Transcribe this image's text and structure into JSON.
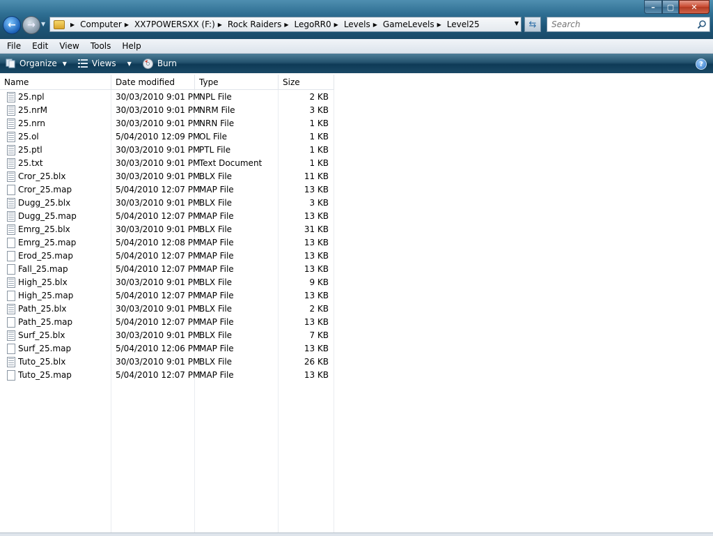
{
  "window": {
    "caption_buttons": {
      "minimize": "–",
      "maximize": "▢",
      "close": "✕"
    }
  },
  "nav": {
    "back_icon": "back-arrow-icon",
    "forward_icon": "forward-arrow-icon"
  },
  "address": {
    "breadcrumbs": [
      "Computer",
      "XX7POWERSXX (F:)",
      "Rock Raiders",
      "LegoRR0",
      "Levels",
      "GameLevels",
      "Level25"
    ]
  },
  "search": {
    "placeholder": "Search"
  },
  "menu": [
    "File",
    "Edit",
    "View",
    "Tools",
    "Help"
  ],
  "toolbar": {
    "organize": "Organize",
    "views": "Views",
    "burn": "Burn",
    "help": "?"
  },
  "columns": {
    "name": "Name",
    "date": "Date modified",
    "type": "Type",
    "size": "Size"
  },
  "files": [
    {
      "name": "25.npl",
      "date": "30/03/2010 9:01 PM",
      "type": "NPL File",
      "size": "2 KB",
      "icon": "lined"
    },
    {
      "name": "25.nrM",
      "date": "30/03/2010 9:01 PM",
      "type": "NRM File",
      "size": "3 KB",
      "icon": "lined"
    },
    {
      "name": "25.nrn",
      "date": "30/03/2010 9:01 PM",
      "type": "NRN File",
      "size": "1 KB",
      "icon": "lined"
    },
    {
      "name": "25.ol",
      "date": "5/04/2010 12:09 PM",
      "type": "OL File",
      "size": "1 KB",
      "icon": "lined"
    },
    {
      "name": "25.ptl",
      "date": "30/03/2010 9:01 PM",
      "type": "PTL File",
      "size": "1 KB",
      "icon": "lined"
    },
    {
      "name": "25.txt",
      "date": "30/03/2010 9:01 PM",
      "type": "Text Document",
      "size": "1 KB",
      "icon": "lined"
    },
    {
      "name": "Cror_25.blx",
      "date": "30/03/2010 9:01 PM",
      "type": "BLX File",
      "size": "11 KB",
      "icon": "lined"
    },
    {
      "name": "Cror_25.map",
      "date": "5/04/2010 12:07 PM",
      "type": "MAP File",
      "size": "13 KB",
      "icon": "blank"
    },
    {
      "name": "Dugg_25.blx",
      "date": "30/03/2010 9:01 PM",
      "type": "BLX File",
      "size": "3 KB",
      "icon": "lined"
    },
    {
      "name": "Dugg_25.map",
      "date": "5/04/2010 12:07 PM",
      "type": "MAP File",
      "size": "13 KB",
      "icon": "lined"
    },
    {
      "name": "Emrg_25.blx",
      "date": "30/03/2010 9:01 PM",
      "type": "BLX File",
      "size": "31 KB",
      "icon": "lined"
    },
    {
      "name": "Emrg_25.map",
      "date": "5/04/2010 12:08 PM",
      "type": "MAP File",
      "size": "13 KB",
      "icon": "blank"
    },
    {
      "name": "Erod_25.map",
      "date": "5/04/2010 12:07 PM",
      "type": "MAP File",
      "size": "13 KB",
      "icon": "blank"
    },
    {
      "name": "Fall_25.map",
      "date": "5/04/2010 12:07 PM",
      "type": "MAP File",
      "size": "13 KB",
      "icon": "blank"
    },
    {
      "name": "High_25.blx",
      "date": "30/03/2010 9:01 PM",
      "type": "BLX File",
      "size": "9 KB",
      "icon": "lined"
    },
    {
      "name": "High_25.map",
      "date": "5/04/2010 12:07 PM",
      "type": "MAP File",
      "size": "13 KB",
      "icon": "blank"
    },
    {
      "name": "Path_25.blx",
      "date": "30/03/2010 9:01 PM",
      "type": "BLX File",
      "size": "2 KB",
      "icon": "lined"
    },
    {
      "name": "Path_25.map",
      "date": "5/04/2010 12:07 PM",
      "type": "MAP File",
      "size": "13 KB",
      "icon": "blank"
    },
    {
      "name": "Surf_25.blx",
      "date": "30/03/2010 9:01 PM",
      "type": "BLX File",
      "size": "7 KB",
      "icon": "lined"
    },
    {
      "name": "Surf_25.map",
      "date": "5/04/2010 12:06 PM",
      "type": "MAP File",
      "size": "13 KB",
      "icon": "blank"
    },
    {
      "name": "Tuto_25.blx",
      "date": "30/03/2010 9:01 PM",
      "type": "BLX File",
      "size": "26 KB",
      "icon": "lined"
    },
    {
      "name": "Tuto_25.map",
      "date": "5/04/2010 12:07 PM",
      "type": "MAP File",
      "size": "13 KB",
      "icon": "blank"
    }
  ]
}
